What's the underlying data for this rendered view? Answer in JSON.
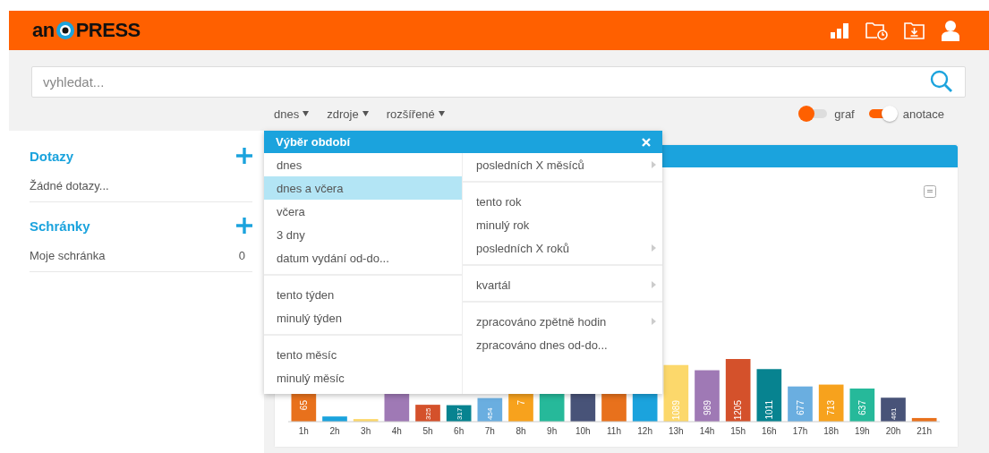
{
  "header": {
    "logo": {
      "left": "an",
      "right": "PRESS"
    }
  },
  "search": {
    "placeholder": "vyhledat..."
  },
  "filters": [
    {
      "label": "dnes"
    },
    {
      "label": "zdroje"
    },
    {
      "label": "rozšířené"
    }
  ],
  "toggles": [
    {
      "label": "graf",
      "on": false
    },
    {
      "label": "anotace",
      "on": true
    }
  ],
  "sidebar": {
    "sections": [
      {
        "title": "Dotazy",
        "items": [
          {
            "label": "Žádné dotazy..."
          }
        ]
      },
      {
        "title": "Schránky",
        "items": [
          {
            "label": "Moje schránka",
            "count": "0"
          }
        ]
      }
    ]
  },
  "chart_panel": {
    "bars": [
      {
        "hour": "1h",
        "value_label": "65"
      },
      {
        "hour": "2h"
      },
      {
        "hour": "3h"
      },
      {
        "hour": "4h"
      },
      {
        "hour": "5h",
        "value_label": "325"
      },
      {
        "hour": "6h",
        "value_label": "317"
      },
      {
        "hour": "7h",
        "value_label": "454"
      },
      {
        "hour": "8h",
        "value_label": "7"
      },
      {
        "hour": "9h"
      },
      {
        "hour": "10h"
      },
      {
        "hour": "11h"
      },
      {
        "hour": "12h"
      },
      {
        "hour": "13h",
        "value_label": "1089"
      },
      {
        "hour": "14h",
        "value_label": "989"
      },
      {
        "hour": "15h",
        "value_label": "1205"
      },
      {
        "hour": "16h",
        "value_label": "1011"
      },
      {
        "hour": "17h",
        "value_label": "677"
      },
      {
        "hour": "18h",
        "value_label": "713"
      },
      {
        "hour": "19h",
        "value_label": "637"
      },
      {
        "hour": "20h",
        "value_label": "461"
      },
      {
        "hour": "21h"
      }
    ]
  },
  "period_menu": {
    "title": "Výběr období",
    "columns": [
      {
        "groups": [
          [
            {
              "label": "dnes",
              "selected": false,
              "submenu": false
            },
            {
              "label": "dnes a včera",
              "selected": true,
              "submenu": false
            },
            {
              "label": "včera",
              "selected": false,
              "submenu": false
            },
            {
              "label": "3 dny",
              "selected": false,
              "submenu": false
            },
            {
              "label": "datum vydání od-do...",
              "selected": false,
              "submenu": false
            }
          ],
          [
            {
              "label": "tento týden",
              "selected": false,
              "submenu": false
            },
            {
              "label": "minulý týden",
              "selected": false,
              "submenu": false
            }
          ],
          [
            {
              "label": "tento měsíc",
              "selected": false,
              "submenu": false
            },
            {
              "label": "minulý měsíc",
              "selected": false,
              "submenu": false
            }
          ]
        ]
      },
      {
        "groups": [
          [
            {
              "label": "posledních X měsíců",
              "selected": false,
              "submenu": true
            }
          ],
          [
            {
              "label": "tento rok",
              "selected": false,
              "submenu": false
            },
            {
              "label": "minulý rok",
              "selected": false,
              "submenu": false
            },
            {
              "label": "posledních X roků",
              "selected": false,
              "submenu": true
            }
          ],
          [
            {
              "label": "kvartál",
              "selected": false,
              "submenu": true
            }
          ],
          [
            {
              "label": "zpracováno zpětně hodin",
              "selected": false,
              "submenu": true
            },
            {
              "label": "zpracováno dnes od-do...",
              "selected": false,
              "submenu": false
            }
          ]
        ]
      }
    ]
  }
}
